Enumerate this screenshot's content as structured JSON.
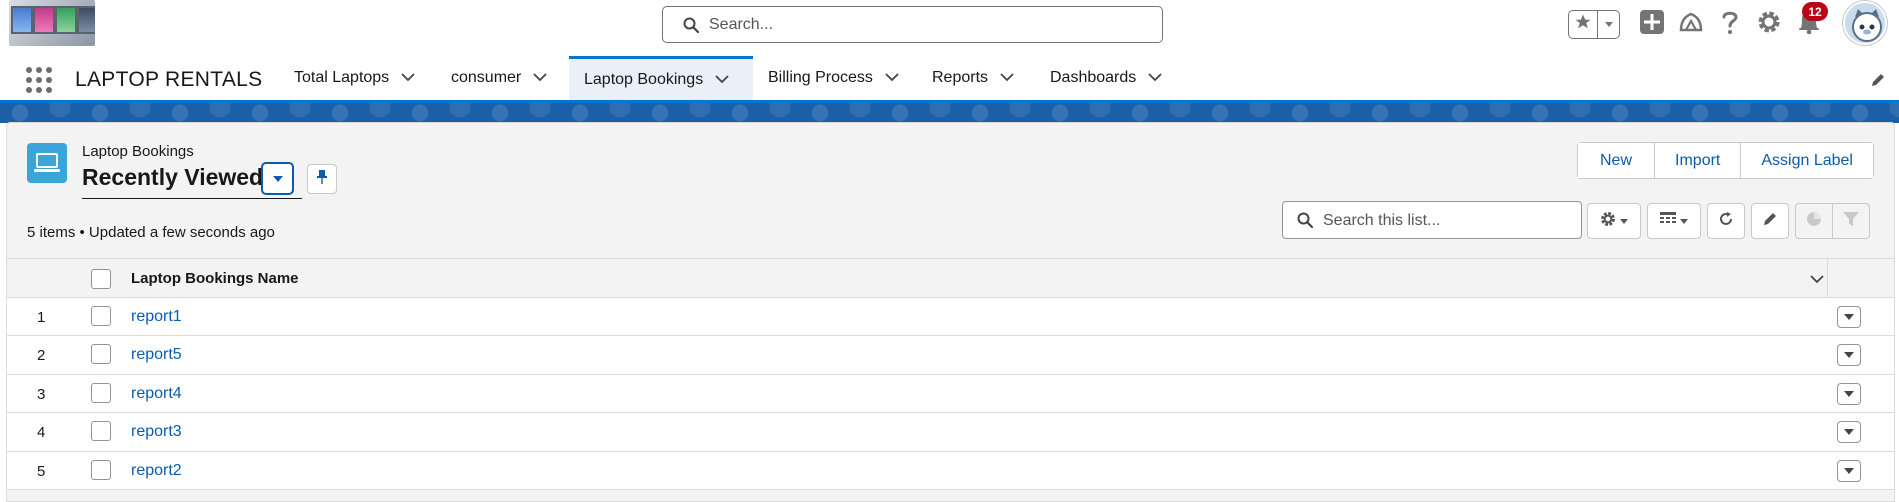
{
  "header": {
    "search_placeholder": "Search...",
    "notification_count": "12"
  },
  "nav": {
    "app_name": "LAPTOP RENTALS",
    "tabs": [
      {
        "label": "Total Laptops"
      },
      {
        "label": "consumer"
      },
      {
        "label": "Laptop Bookings",
        "active": true
      },
      {
        "label": "Billing Process"
      },
      {
        "label": "Reports"
      },
      {
        "label": "Dashboards"
      }
    ]
  },
  "list": {
    "object_label": "Laptop Bookings",
    "view_name": "Recently Viewed",
    "meta": "5 items • Updated a few seconds ago",
    "buttons": {
      "new": "New",
      "import": "Import",
      "assign_label": "Assign Label"
    },
    "search_placeholder": "Search this list...",
    "column_header": "Laptop Bookings Name",
    "rows": [
      {
        "num": "1",
        "name": "report1"
      },
      {
        "num": "2",
        "name": "report5"
      },
      {
        "num": "3",
        "name": "report4"
      },
      {
        "num": "4",
        "name": "report3"
      },
      {
        "num": "5",
        "name": "report2"
      }
    ]
  },
  "colors": {
    "brand": "#0176d3",
    "link": "#0b5cab",
    "object_icon": "#3ba4d8",
    "badge": "#ba0517"
  },
  "icons": [
    "search-icon",
    "star-icon",
    "add-icon",
    "trailhead-icon",
    "help-icon",
    "gear-icon",
    "bell-icon",
    "app-launcher-icon",
    "pencil-icon",
    "pin-icon",
    "refresh-icon",
    "table-icon",
    "chart-icon",
    "filter-icon",
    "chevron-down-icon",
    "laptop-icon"
  ]
}
